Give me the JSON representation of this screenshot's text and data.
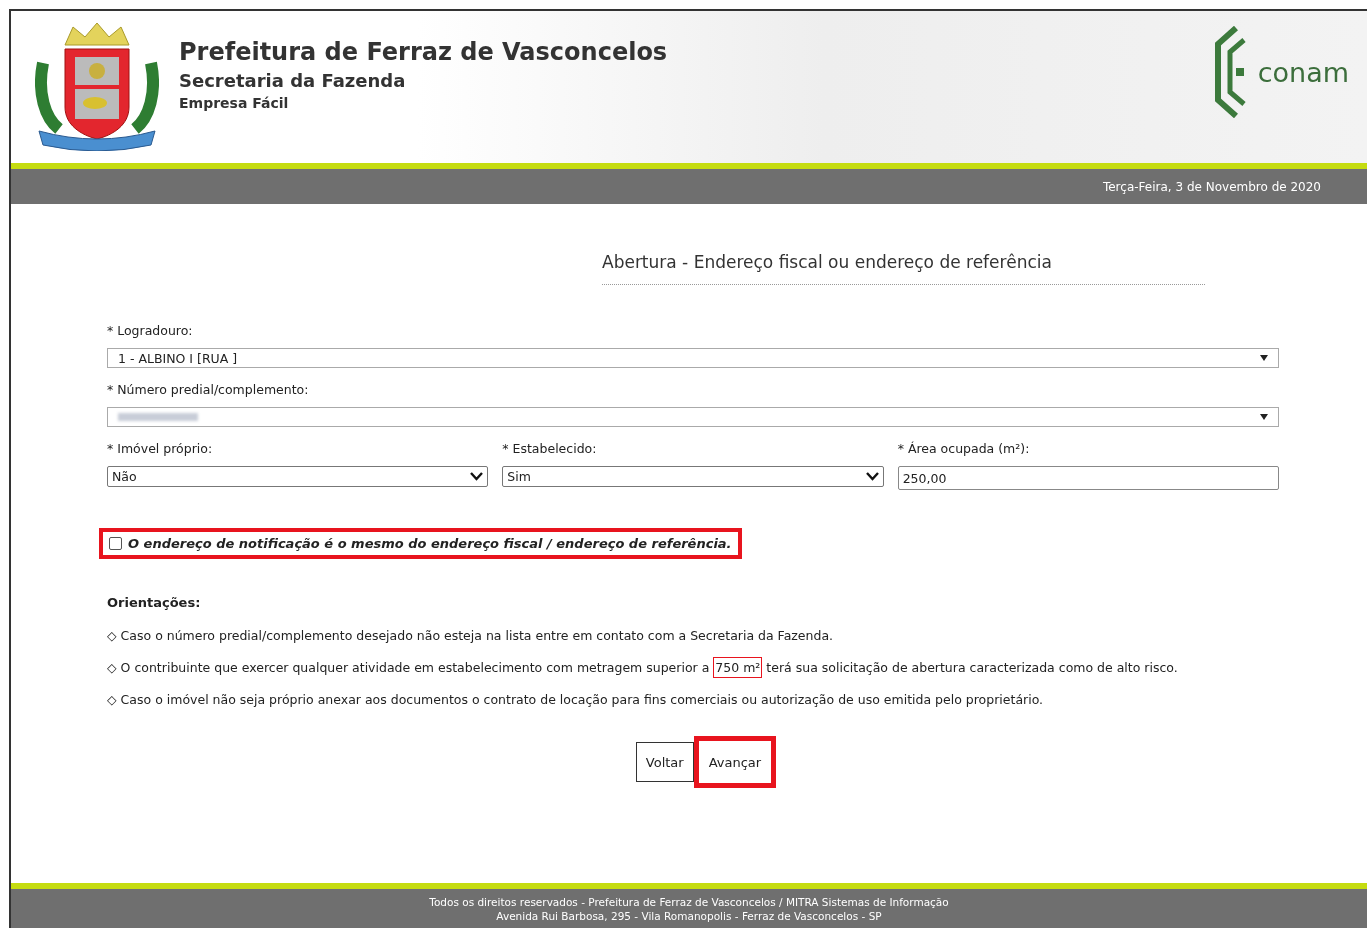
{
  "header": {
    "title": "Prefeitura de Ferraz de Vasconcelos",
    "subtitle": "Secretaria da Fazenda",
    "section": "Empresa Fácil",
    "brand": "conam"
  },
  "date_bar": {
    "date": "Terça-Feira, 3 de Novembro de 2020"
  },
  "page_title": "Abertura - Endereço fiscal ou endereço de referência",
  "fields": [
    {
      "kind": "combo",
      "label": "* Logradouro:",
      "value": "1 - ALBINO I [RUA ]",
      "redacted": false
    },
    {
      "kind": "combo",
      "label": "* Número predial/complemento:",
      "redacted": true
    }
  ],
  "row_fields": [
    {
      "kind": "select",
      "label": "* Imóvel próprio:",
      "value": "Não"
    },
    {
      "kind": "select",
      "label": "* Estabelecido:",
      "value": "Sim"
    },
    {
      "kind": "text",
      "label": "* Área ocupada (m²):",
      "value": "250,00"
    }
  ],
  "notification_checkbox": {
    "label": "O endereço de notificação é o mesmo do endereço fiscal / endereço de referência.",
    "checked": false,
    "highlighted": true
  },
  "guidance": {
    "title": "Orientações:",
    "items": [
      {
        "bullet": "◇",
        "text": "Caso o número predial/complemento desejado não esteja na lista entre em contato com a Secretaria da Fazenda."
      },
      {
        "bullet": "◇",
        "text": "O contribuinte que exercer qualquer atividade em estabelecimento com metragem superior a",
        "highlight": "750 m²",
        "text_after": "terá sua solicitação de abertura caracterizada como de alto risco."
      },
      {
        "bullet": "◇",
        "text": "Caso o imóvel não seja próprio anexar aos documentos o contrato de locação para fins comerciais ou autorização de uso emitida pelo proprietário."
      }
    ]
  },
  "buttons": [
    {
      "label": "Voltar",
      "highlighted": false
    },
    {
      "label": "Avançar",
      "highlighted": true
    }
  ],
  "footer": [
    "Todos os direitos reservados - Prefeitura de Ferraz de Vasconcelos / MITRA Sistemas de Informação",
    "Avenida Rui Barbosa, 295 - Vila Romanopolis - Ferraz de Vasconcelos - SP"
  ]
}
